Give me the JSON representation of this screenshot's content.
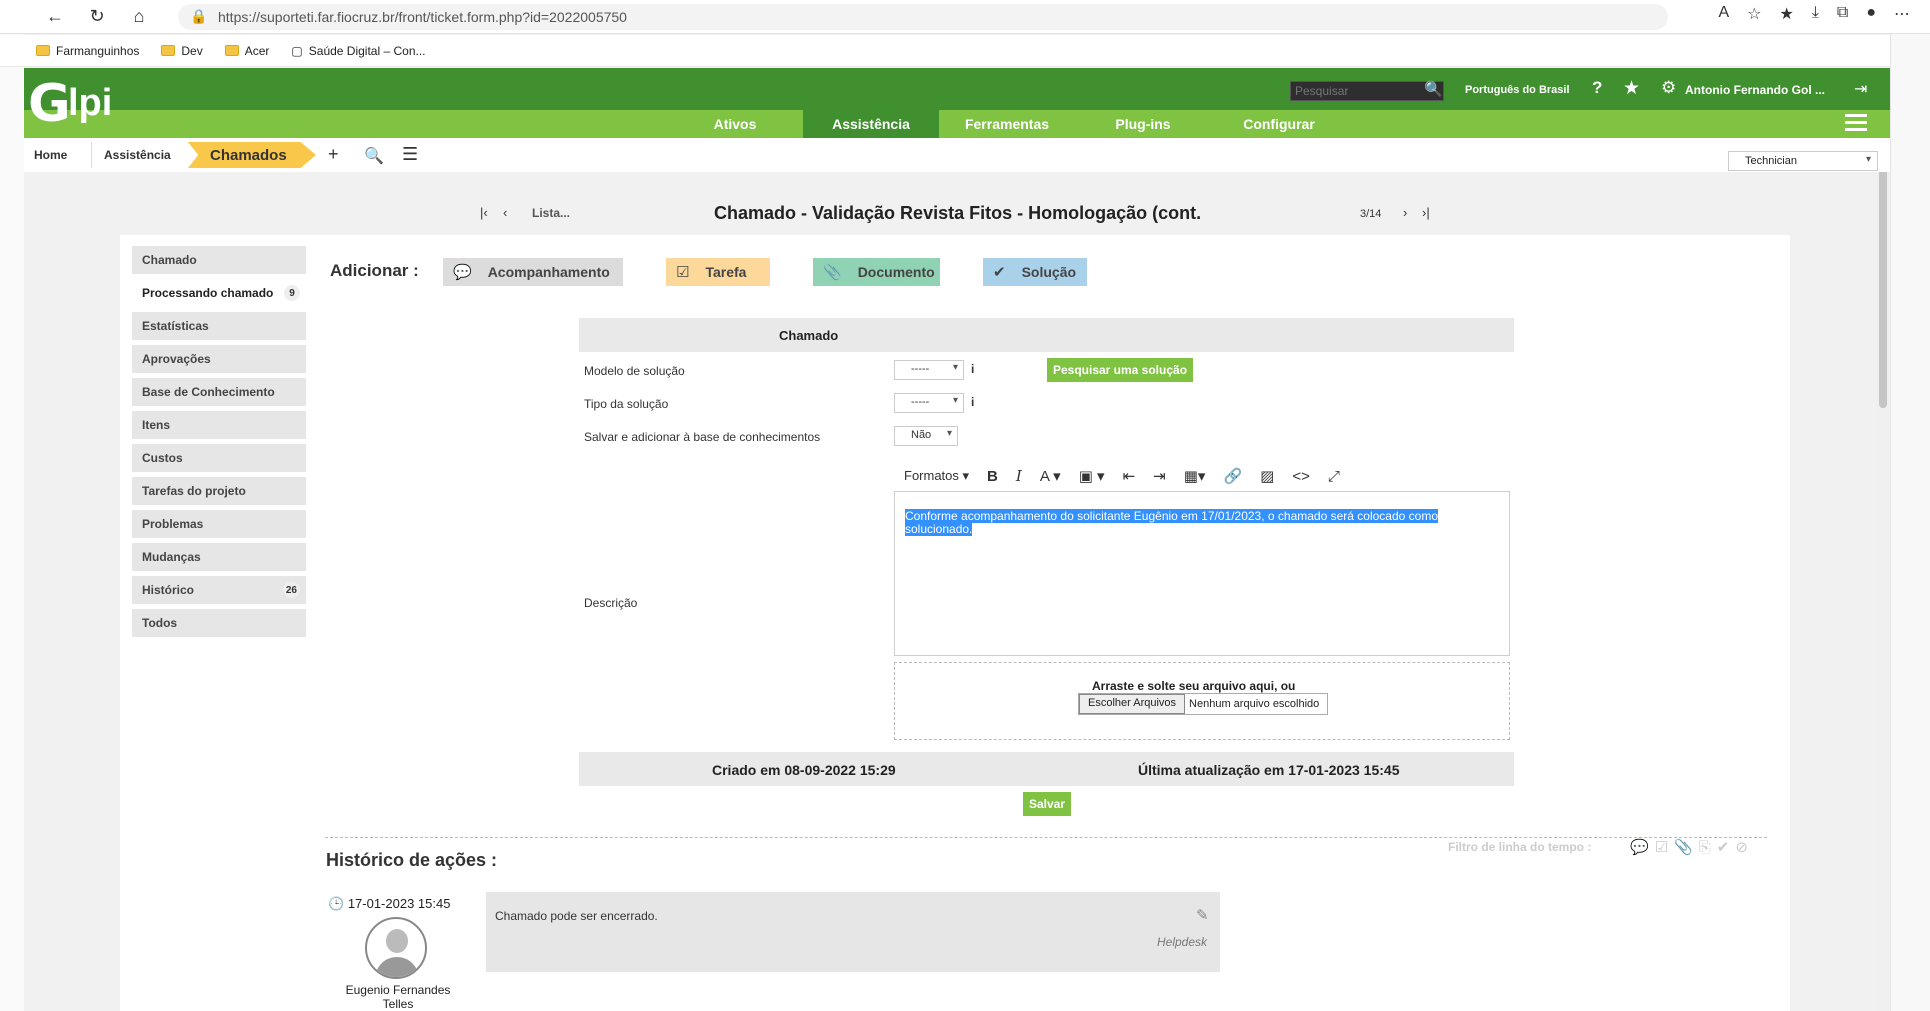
{
  "browser": {
    "url": "https://suporteti.far.fiocruz.br/front/ticket.form.php?id=2022005750",
    "bookmarks": [
      "Farmanguinhos",
      "Dev",
      "Acer",
      "Saúde Digital – Con..."
    ]
  },
  "header": {
    "logo_text": "lpi",
    "search_placeholder": "Pesquisar",
    "language": "Português do Brasil",
    "user": "Antonio Fernando Gol ..."
  },
  "menu": {
    "items": [
      {
        "label": "Ativos",
        "active": false
      },
      {
        "label": "Assistência",
        "active": true
      },
      {
        "label": "Ferramentas",
        "active": false
      },
      {
        "label": "Plug-ins",
        "active": false
      },
      {
        "label": "Configurar",
        "active": false
      }
    ]
  },
  "breadcrumb": {
    "home": "Home",
    "assistance": "Assistência",
    "current": "Chamados",
    "profile": "Technician"
  },
  "ticket": {
    "list_link": "Lista...",
    "title": "Chamado - Validação Revista Fitos - Homologação (cont.",
    "position": "3/14"
  },
  "sidebar": {
    "tabs": [
      {
        "label": "Chamado",
        "badge": ""
      },
      {
        "label": "Processando chamado",
        "badge": "9"
      },
      {
        "label": "Estatísticas",
        "badge": ""
      },
      {
        "label": "Aprovações",
        "badge": ""
      },
      {
        "label": "Base de Conhecimento",
        "badge": ""
      },
      {
        "label": "Itens",
        "badge": ""
      },
      {
        "label": "Custos",
        "badge": ""
      },
      {
        "label": "Tarefas do projeto",
        "badge": ""
      },
      {
        "label": "Problemas",
        "badge": ""
      },
      {
        "label": "Mudanças",
        "badge": ""
      },
      {
        "label": "Histórico",
        "badge": "26"
      },
      {
        "label": "Todos",
        "badge": ""
      }
    ]
  },
  "add": {
    "label": "Adicionar :",
    "followup": "Acompanhamento",
    "task": "Tarefa",
    "document": "Documento",
    "solution": "Solução",
    "colors": {
      "followup": "#dcdcdc",
      "task": "#fcd99a",
      "document": "#8fd2b4",
      "solution": "#a9d1ea"
    }
  },
  "form": {
    "header": "Chamado",
    "solution_template_label": "Modelo de solução",
    "solution_template_value": "-----",
    "solution_type_label": "Tipo da solução",
    "solution_type_value": "-----",
    "save_kb_label": "Salvar e adicionar à base de conhecimentos",
    "save_kb_value": "Não",
    "search_solution_button": "Pesquisar uma solução",
    "description_label": "Descrição",
    "formats": "Formatos",
    "description_text": "Conforme acompanhamento do solicitante Eugênio em 17/01/2023, o chamado será colocado como solucionado.",
    "dropzone_title": "Arraste e solte seu arquivo aqui, ou",
    "choose_files": "Escolher Arquivos",
    "no_file": "Nenhum arquivo escolhido",
    "created": "Criado em 08-09-2022 15:29",
    "updated": "Última atualização em 17-01-2023 15:45",
    "save_button": "Salvar"
  },
  "history": {
    "title": "Histórico de ações :",
    "filter_label": "Filtro de linha do tempo :",
    "entry_date": "17-01-2023 15:45",
    "entry_author": "Eugenio Fernandes Telles",
    "entry_text": "Chamado pode ser encerrado.",
    "entry_source": "Helpdesk"
  }
}
